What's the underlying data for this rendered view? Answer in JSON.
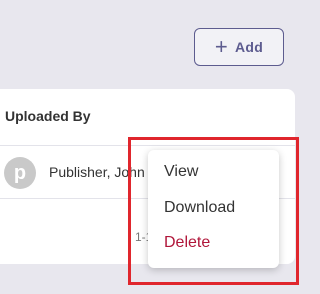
{
  "toolbar": {
    "add_label": "Add"
  },
  "table": {
    "column_header": "Uploaded By",
    "rows": [
      {
        "avatar_letter": "p",
        "uploader": "Publisher, John"
      }
    ],
    "pagination_text": "1-1"
  },
  "context_menu": {
    "items": [
      "View",
      "Download",
      "Delete"
    ],
    "delete_color": "#b0163a"
  },
  "colors": {
    "accent": "#5d5c8f",
    "background": "#e8e7ee",
    "highlight": "#e0262d"
  }
}
